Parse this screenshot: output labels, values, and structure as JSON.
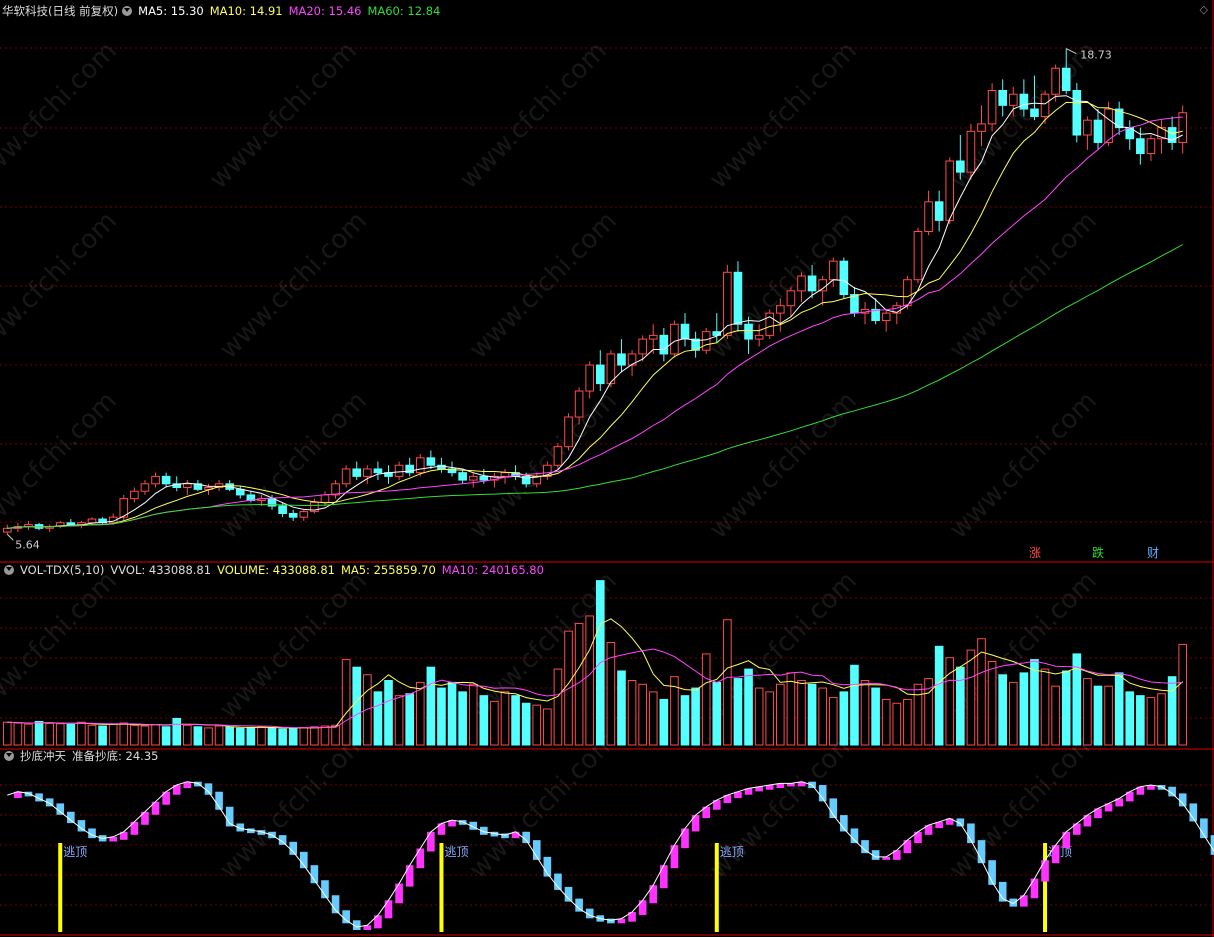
{
  "main_header": {
    "title": "华软科技(日线 前复权)",
    "ma5": "MA5: 15.30",
    "ma10": "MA10: 14.91",
    "ma20": "MA20: 15.46",
    "ma60": "MA60: 12.84"
  },
  "vol_header": {
    "name": "VOL-TDX(5,10)",
    "vvol": "VVOL: 433088.81",
    "volume": "VOLUME: 433088.81",
    "ma5": "MA5: 255859.70",
    "ma10": "MA10: 240165.80"
  },
  "ind_header": {
    "name": "抄底冲天",
    "value": "准备抄底: 24.35"
  },
  "tags": {
    "up": "涨",
    "down": "跌",
    "fin": "财"
  },
  "watermark": "www.cfchi.com",
  "colors": {
    "up": "#ff4a4a",
    "down": "#54ffff",
    "ma5": "#ffffff",
    "ma10": "#ffff55",
    "ma20": "#ff44ff",
    "ma60": "#33dd33",
    "grid": "#7a0000",
    "border": "#b00000",
    "ind_up": "#ff33ff",
    "ind_down": "#66ccff",
    "signal": "#ffff00"
  },
  "chart_data": [
    {
      "type": "candlestick",
      "title": "华软科技(日线 前复权)",
      "y_range": [
        5.0,
        19.5
      ],
      "high_label": "18.73",
      "low_label": "5.64",
      "ohlc": [
        [
          5.7,
          5.9,
          5.64,
          5.8
        ],
        [
          5.8,
          5.95,
          5.7,
          5.85
        ],
        [
          5.85,
          6.0,
          5.75,
          5.9
        ],
        [
          5.9,
          5.95,
          5.75,
          5.8
        ],
        [
          5.8,
          5.9,
          5.7,
          5.85
        ],
        [
          5.85,
          6.0,
          5.8,
          5.95
        ],
        [
          5.95,
          6.05,
          5.85,
          5.9
        ],
        [
          5.9,
          6.0,
          5.8,
          5.95
        ],
        [
          5.95,
          6.1,
          5.9,
          6.05
        ],
        [
          6.05,
          6.1,
          5.9,
          5.95
        ],
        [
          5.95,
          6.2,
          5.9,
          6.1
        ],
        [
          6.1,
          6.7,
          6.0,
          6.6
        ],
        [
          6.6,
          6.9,
          6.5,
          6.8
        ],
        [
          6.8,
          7.1,
          6.7,
          7.0
        ],
        [
          7.0,
          7.3,
          6.9,
          7.2
        ],
        [
          7.2,
          7.3,
          6.9,
          7.0
        ],
        [
          7.0,
          7.2,
          6.8,
          6.9
        ],
        [
          6.9,
          7.1,
          6.7,
          7.0
        ],
        [
          7.0,
          7.1,
          6.8,
          6.85
        ],
        [
          6.85,
          7.0,
          6.7,
          6.9
        ],
        [
          6.9,
          7.1,
          6.8,
          7.0
        ],
        [
          7.0,
          7.1,
          6.8,
          6.85
        ],
        [
          6.85,
          6.95,
          6.6,
          6.7
        ],
        [
          6.7,
          6.8,
          6.5,
          6.55
        ],
        [
          6.55,
          6.7,
          6.4,
          6.6
        ],
        [
          6.6,
          6.7,
          6.3,
          6.4
        ],
        [
          6.4,
          6.5,
          6.1,
          6.2
        ],
        [
          6.2,
          6.3,
          6.0,
          6.1
        ],
        [
          6.1,
          6.3,
          6.0,
          6.25
        ],
        [
          6.25,
          6.6,
          6.2,
          6.5
        ],
        [
          6.5,
          6.8,
          6.4,
          6.7
        ],
        [
          6.7,
          7.1,
          6.6,
          7.0
        ],
        [
          7.0,
          7.5,
          6.9,
          7.4
        ],
        [
          7.4,
          7.6,
          7.1,
          7.2
        ],
        [
          7.2,
          7.5,
          7.0,
          7.4
        ],
        [
          7.4,
          7.6,
          7.1,
          7.3
        ],
        [
          7.3,
          7.5,
          7.0,
          7.2
        ],
        [
          7.2,
          7.6,
          7.1,
          7.5
        ],
        [
          7.5,
          7.7,
          7.2,
          7.3
        ],
        [
          7.3,
          7.8,
          7.2,
          7.7
        ],
        [
          7.7,
          7.9,
          7.4,
          7.5
        ],
        [
          7.5,
          7.7,
          7.3,
          7.4
        ],
        [
          7.4,
          7.6,
          7.2,
          7.3
        ],
        [
          7.3,
          7.4,
          7.0,
          7.1
        ],
        [
          7.1,
          7.3,
          6.9,
          7.2
        ],
        [
          7.2,
          7.4,
          7.0,
          7.1
        ],
        [
          7.1,
          7.3,
          6.9,
          7.2
        ],
        [
          7.2,
          7.4,
          7.0,
          7.3
        ],
        [
          7.3,
          7.5,
          7.1,
          7.2
        ],
        [
          7.2,
          7.3,
          6.9,
          7.0
        ],
        [
          7.0,
          7.3,
          6.9,
          7.2
        ],
        [
          7.2,
          7.6,
          7.1,
          7.5
        ],
        [
          7.5,
          8.1,
          7.4,
          8.0
        ],
        [
          8.0,
          8.9,
          7.9,
          8.8
        ],
        [
          8.8,
          9.6,
          8.6,
          9.5
        ],
        [
          9.5,
          10.3,
          9.3,
          10.2
        ],
        [
          10.2,
          10.6,
          9.5,
          9.7
        ],
        [
          9.7,
          10.6,
          9.6,
          10.5
        ],
        [
          10.5,
          10.9,
          10.0,
          10.2
        ],
        [
          10.2,
          10.6,
          9.9,
          10.5
        ],
        [
          10.5,
          11.0,
          10.3,
          10.9
        ],
        [
          10.9,
          11.3,
          10.5,
          11.0
        ],
        [
          11.0,
          11.2,
          10.3,
          10.5
        ],
        [
          10.5,
          11.4,
          10.4,
          11.3
        ],
        [
          11.3,
          11.6,
          10.7,
          10.9
        ],
        [
          10.9,
          11.1,
          10.4,
          10.6
        ],
        [
          10.6,
          11.2,
          10.5,
          11.1
        ],
        [
          11.1,
          11.6,
          10.8,
          11.0
        ],
        [
          11.0,
          12.9,
          10.9,
          12.7
        ],
        [
          12.7,
          13.0,
          11.1,
          11.3
        ],
        [
          11.3,
          11.5,
          10.5,
          10.9
        ],
        [
          10.9,
          11.3,
          10.7,
          11.0
        ],
        [
          11.0,
          11.7,
          10.9,
          11.6
        ],
        [
          11.6,
          12.0,
          11.1,
          11.8
        ],
        [
          11.8,
          12.3,
          11.5,
          12.2
        ],
        [
          12.2,
          12.7,
          11.9,
          12.6
        ],
        [
          12.6,
          12.9,
          12.0,
          12.2
        ],
        [
          12.2,
          12.6,
          11.8,
          12.5
        ],
        [
          12.5,
          13.1,
          12.3,
          13.0
        ],
        [
          13.0,
          13.1,
          12.0,
          12.1
        ],
        [
          12.1,
          12.3,
          11.5,
          11.6
        ],
        [
          11.6,
          11.9,
          11.3,
          11.7
        ],
        [
          11.7,
          12.0,
          11.3,
          11.4
        ],
        [
          11.4,
          11.7,
          11.1,
          11.6
        ],
        [
          11.6,
          11.9,
          11.3,
          11.8
        ],
        [
          11.8,
          12.6,
          11.7,
          12.5
        ],
        [
          12.5,
          13.9,
          12.4,
          13.8
        ],
        [
          13.8,
          14.9,
          13.7,
          14.6
        ],
        [
          14.6,
          14.9,
          13.8,
          14.1
        ],
        [
          14.1,
          15.8,
          14.0,
          15.7
        ],
        [
          15.7,
          16.4,
          15.2,
          15.4
        ],
        [
          15.4,
          16.7,
          15.2,
          16.5
        ],
        [
          16.5,
          17.2,
          16.1,
          16.7
        ],
        [
          16.7,
          17.8,
          16.5,
          17.6
        ],
        [
          17.6,
          17.9,
          16.9,
          17.2
        ],
        [
          17.2,
          17.7,
          16.9,
          17.5
        ],
        [
          17.5,
          17.9,
          16.9,
          17.1
        ],
        [
          17.1,
          18.0,
          16.8,
          16.9
        ],
        [
          16.9,
          17.6,
          16.7,
          17.5
        ],
        [
          17.5,
          18.3,
          17.3,
          18.2
        ],
        [
          18.2,
          18.73,
          17.5,
          17.6
        ],
        [
          17.6,
          17.8,
          16.2,
          16.4
        ],
        [
          16.4,
          16.9,
          16.0,
          16.8
        ],
        [
          16.8,
          17.1,
          16.0,
          16.2
        ],
        [
          16.2,
          17.3,
          16.1,
          17.1
        ],
        [
          17.1,
          17.3,
          16.4,
          16.6
        ],
        [
          16.6,
          16.8,
          16.0,
          16.3
        ],
        [
          16.3,
          16.6,
          15.6,
          15.9
        ],
        [
          15.9,
          16.4,
          15.7,
          16.3
        ],
        [
          16.3,
          16.8,
          15.9,
          16.6
        ],
        [
          16.6,
          16.9,
          16.0,
          16.2
        ],
        [
          16.2,
          17.2,
          15.9,
          17.0
        ]
      ]
    },
    {
      "type": "bar",
      "title": "VOL-TDX(5,10)",
      "y_range": [
        0,
        440000
      ],
      "volume": [
        60000,
        58000,
        55000,
        62000,
        57000,
        56000,
        54000,
        60000,
        52000,
        50000,
        55000,
        58000,
        52000,
        50000,
        54000,
        48000,
        70000,
        52000,
        48000,
        45000,
        50000,
        47000,
        44000,
        46000,
        48000,
        45000,
        42000,
        44000,
        46000,
        48000,
        50000,
        52000,
        225000,
        205000,
        185000,
        140000,
        170000,
        130000,
        135000,
        165000,
        205000,
        150000,
        165000,
        140000,
        160000,
        130000,
        115000,
        140000,
        130000,
        110000,
        105000,
        95000,
        200000,
        300000,
        320000,
        340000,
        433088,
        270000,
        195000,
        170000,
        160000,
        140000,
        120000,
        180000,
        130000,
        150000,
        240000,
        165000,
        330000,
        175000,
        200000,
        150000,
        140000,
        160000,
        190000,
        170000,
        160000,
        150000,
        125000,
        140000,
        210000,
        170000,
        150000,
        120000,
        110000,
        120000,
        160000,
        175000,
        260000,
        230000,
        205000,
        250000,
        280000,
        220000,
        185000,
        165000,
        190000,
        225000,
        200000,
        155000,
        195000,
        240000,
        175000,
        155000,
        155000,
        190000,
        140000,
        130000,
        125000,
        135000,
        180000,
        265000
      ]
    },
    {
      "type": "bar",
      "title": "抄底冲天",
      "y_range": [
        0,
        100
      ],
      "value": [
        82,
        84,
        83,
        80,
        77,
        72,
        67,
        62,
        58,
        56,
        57,
        60,
        66,
        72,
        78,
        84,
        88,
        90,
        89,
        84,
        75,
        65,
        62,
        61,
        60,
        58,
        54,
        48,
        40,
        31,
        22,
        13,
        7,
        3,
        4,
        10,
        19,
        29,
        40,
        50,
        60,
        65,
        67,
        66,
        63,
        60,
        59,
        58,
        60,
        55,
        45,
        35,
        27,
        20,
        14,
        10,
        8,
        7,
        8,
        12,
        19,
        28,
        40,
        52,
        62,
        70,
        75,
        79,
        82,
        84,
        86,
        87,
        88,
        89,
        89,
        90,
        88,
        80,
        70,
        62,
        55,
        49,
        45,
        45,
        49,
        55,
        60,
        64,
        66,
        68,
        65,
        55,
        43,
        30,
        20,
        17,
        22,
        32,
        43,
        52,
        60,
        65,
        70,
        74,
        77,
        80,
        84,
        87,
        88,
        87,
        83,
        77,
        68,
        58,
        48,
        40,
        34,
        28,
        22,
        17,
        12,
        8,
        5,
        3,
        4,
        7,
        12,
        17,
        24.35
      ],
      "signals": [
        {
          "index": 5,
          "label": "逃顶"
        },
        {
          "index": 41,
          "label": "逃顶"
        },
        {
          "index": 67,
          "label": "逃顶"
        },
        {
          "index": 98,
          "label": "逃顶"
        }
      ]
    }
  ]
}
